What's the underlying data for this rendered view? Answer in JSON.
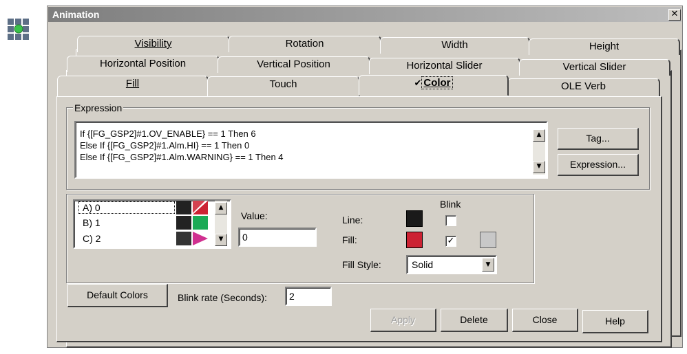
{
  "window": {
    "title": "Animation",
    "close_glyph": "✕"
  },
  "tabs": {
    "row1": [
      {
        "label": "Visibility"
      },
      {
        "label": "Rotation"
      },
      {
        "label": "Width"
      },
      {
        "label": "Height"
      }
    ],
    "row2": [
      {
        "label": "Horizontal Position"
      },
      {
        "label": "Vertical Position"
      },
      {
        "label": "Horizontal Slider"
      },
      {
        "label": "Vertical Slider"
      }
    ],
    "row3": [
      {
        "label": "Fill"
      },
      {
        "label": "Touch"
      },
      {
        "label": "Color",
        "check": "✔",
        "active": true
      },
      {
        "label": "OLE Verb"
      }
    ]
  },
  "expression": {
    "group_label": "Expression",
    "lines": [
      "If {[FG_GSP2]#1.OV_ENABLE} == 1 Then 6",
      "Else If {[FG_GSP2]#1.Alm.HI} == 1 Then 0",
      "Else If {[FG_GSP2]#1.Alm.WARNING} == 1 Then 4"
    ],
    "tag_button": "Tag...",
    "expression_button": "Expression..."
  },
  "color_list": {
    "items": [
      {
        "label": "A) 0",
        "line_color": "#222222",
        "fill_color": "#cc2233",
        "fill_icon": "diagonal",
        "selected": true
      },
      {
        "label": "B) 1",
        "line_color": "#222222",
        "fill_color": "#1aaa55"
      },
      {
        "label": "C) 2",
        "line_color": "#222222",
        "fill_color": "#d03090",
        "fill_icon": "triangle"
      }
    ]
  },
  "value": {
    "label": "Value:",
    "input": "0"
  },
  "settings": {
    "blink_header": "Blink",
    "line_label": "Line:",
    "line_color": "#1a1a1a",
    "line_blink": false,
    "fill_label": "Fill:",
    "fill_color": "#cc2233",
    "fill_blink": true,
    "fill_blink_color": "#c8c8c8",
    "check_glyph": "✓",
    "fill_style_label": "Fill Style:",
    "fill_style_value": "Solid"
  },
  "bottom": {
    "default_colors": "Default Colors",
    "blink_rate_label": "Blink rate (Seconds):",
    "blink_rate_value": "2",
    "apply": "Apply",
    "delete": "Delete",
    "close": "Close",
    "help": "Help"
  },
  "colors": {
    "dialog_bg": "#d4d0c8",
    "title_grad_start": "#7e7e7e",
    "title_grad_end": "#bdbdbd"
  }
}
